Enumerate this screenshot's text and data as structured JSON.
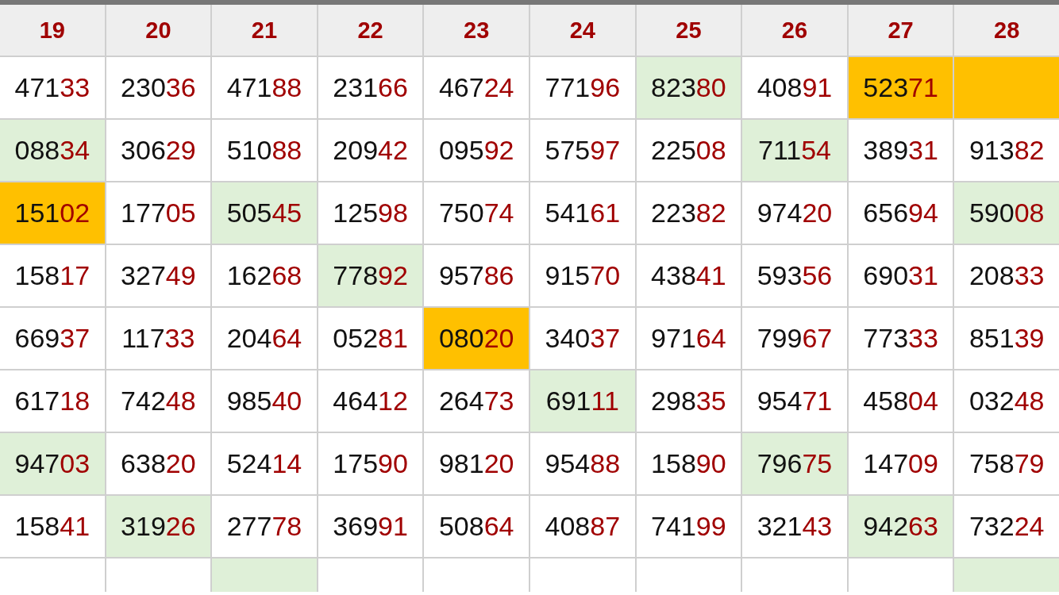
{
  "columns": [
    "19",
    "20",
    "21",
    "22",
    "23",
    "24",
    "25",
    "26",
    "27",
    "28"
  ],
  "rows": [
    [
      {
        "head": "471",
        "tail": "33"
      },
      {
        "head": "230",
        "tail": "36"
      },
      {
        "head": "471",
        "tail": "88"
      },
      {
        "head": "231",
        "tail": "66"
      },
      {
        "head": "467",
        "tail": "24"
      },
      {
        "head": "771",
        "tail": "96"
      },
      {
        "head": "823",
        "tail": "80",
        "color": "#dff0d8"
      },
      {
        "head": "408",
        "tail": "91"
      },
      {
        "head": "523",
        "tail": "71",
        "color": "#ffc000"
      },
      {
        "color": "#ffc000"
      }
    ],
    [
      {
        "head": "088",
        "tail": "34",
        "color": "#dff0d8"
      },
      {
        "head": "306",
        "tail": "29"
      },
      {
        "head": "510",
        "tail": "88"
      },
      {
        "head": "209",
        "tail": "42"
      },
      {
        "head": "095",
        "tail": "92"
      },
      {
        "head": "575",
        "tail": "97"
      },
      {
        "head": "225",
        "tail": "08"
      },
      {
        "head": "711",
        "tail": "54",
        "color": "#dff0d8"
      },
      {
        "head": "389",
        "tail": "31"
      },
      {
        "head": "913",
        "tail": "82"
      }
    ],
    [
      {
        "head": "151",
        "tail": "02",
        "color": "#ffc000"
      },
      {
        "head": "177",
        "tail": "05"
      },
      {
        "head": "505",
        "tail": "45",
        "color": "#dff0d8"
      },
      {
        "head": "125",
        "tail": "98"
      },
      {
        "head": "750",
        "tail": "74"
      },
      {
        "head": "541",
        "tail": "61"
      },
      {
        "head": "223",
        "tail": "82"
      },
      {
        "head": "974",
        "tail": "20"
      },
      {
        "head": "656",
        "tail": "94"
      },
      {
        "head": "590",
        "tail": "08",
        "color": "#dff0d8"
      }
    ],
    [
      {
        "head": "158",
        "tail": "17"
      },
      {
        "head": "327",
        "tail": "49"
      },
      {
        "head": "162",
        "tail": "68"
      },
      {
        "head": "778",
        "tail": "92",
        "color": "#dff0d8"
      },
      {
        "head": "957",
        "tail": "86"
      },
      {
        "head": "915",
        "tail": "70"
      },
      {
        "head": "438",
        "tail": "41"
      },
      {
        "head": "593",
        "tail": "56"
      },
      {
        "head": "690",
        "tail": "31"
      },
      {
        "head": "208",
        "tail": "33"
      }
    ],
    [
      {
        "head": "669",
        "tail": "37"
      },
      {
        "head": "117",
        "tail": "33"
      },
      {
        "head": "204",
        "tail": "64"
      },
      {
        "head": "052",
        "tail": "81"
      },
      {
        "head": "080",
        "tail": "20",
        "color": "#ffc000"
      },
      {
        "head": "340",
        "tail": "37"
      },
      {
        "head": "971",
        "tail": "64"
      },
      {
        "head": "799",
        "tail": "67"
      },
      {
        "head": "773",
        "tail": "33"
      },
      {
        "head": "851",
        "tail": "39"
      }
    ],
    [
      {
        "head": "617",
        "tail": "18"
      },
      {
        "head": "742",
        "tail": "48"
      },
      {
        "head": "985",
        "tail": "40"
      },
      {
        "head": "464",
        "tail": "12"
      },
      {
        "head": "264",
        "tail": "73"
      },
      {
        "head": "691",
        "tail": "11",
        "color": "#dff0d8"
      },
      {
        "head": "298",
        "tail": "35"
      },
      {
        "head": "954",
        "tail": "71"
      },
      {
        "head": "458",
        "tail": "04"
      },
      {
        "head": "032",
        "tail": "48"
      }
    ],
    [
      {
        "head": "947",
        "tail": "03",
        "color": "#dff0d8"
      },
      {
        "head": "638",
        "tail": "20"
      },
      {
        "head": "524",
        "tail": "14"
      },
      {
        "head": "175",
        "tail": "90"
      },
      {
        "head": "981",
        "tail": "20"
      },
      {
        "head": "954",
        "tail": "88"
      },
      {
        "head": "158",
        "tail": "90"
      },
      {
        "head": "796",
        "tail": "75",
        "color": "#dff0d8"
      },
      {
        "head": "147",
        "tail": "09"
      },
      {
        "head": "758",
        "tail": "79"
      }
    ],
    [
      {
        "head": "158",
        "tail": "41"
      },
      {
        "head": "319",
        "tail": "26",
        "color": "#dff0d8"
      },
      {
        "head": "277",
        "tail": "78"
      },
      {
        "head": "369",
        "tail": "91"
      },
      {
        "head": "508",
        "tail": "64"
      },
      {
        "head": "408",
        "tail": "87"
      },
      {
        "head": "741",
        "tail": "99"
      },
      {
        "head": "321",
        "tail": "43"
      },
      {
        "head": "942",
        "tail": "63",
        "color": "#dff0d8"
      },
      {
        "head": "732",
        "tail": "24"
      }
    ],
    [
      {},
      {},
      {
        "color": "#dff0d8"
      },
      {},
      {},
      {},
      {},
      {},
      {},
      {
        "color": "#dff0d8"
      }
    ]
  ]
}
